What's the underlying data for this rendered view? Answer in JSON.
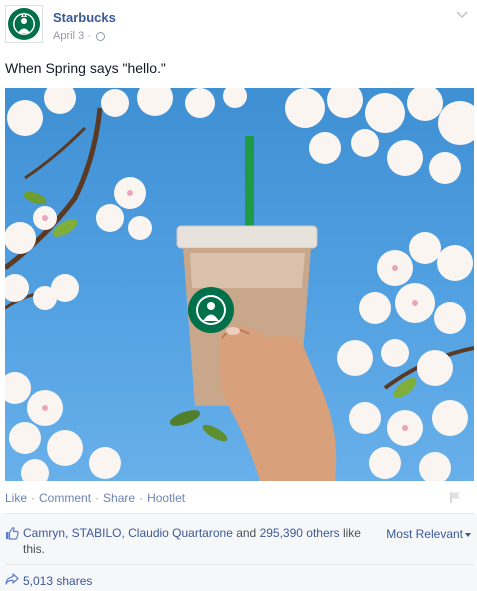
{
  "post": {
    "page_name": "Starbucks",
    "date": "April 3",
    "separator": "·",
    "caption": "When Spring says \"hello.\""
  },
  "actions": {
    "like": "Like",
    "comment": "Comment",
    "share": "Share",
    "hootlet": "Hootlet",
    "dot": "·"
  },
  "likes": {
    "names": "Camryn, STABILO, Claudio Quartarone",
    "and": " and ",
    "others": "295,390 others",
    "suffix": " like this."
  },
  "sort": {
    "label": "Most Relevant"
  },
  "shares": {
    "label": "5,013 shares"
  },
  "colors": {
    "link": "#3b5998",
    "muted": "#9197a3",
    "starbucks_green": "#00704a",
    "sky": "#4e9ee0"
  },
  "icons": [
    "starbucks-logo",
    "globe-icon",
    "chevron-down-icon",
    "flag-icon",
    "thumbs-up-icon",
    "share-arrow-icon"
  ]
}
